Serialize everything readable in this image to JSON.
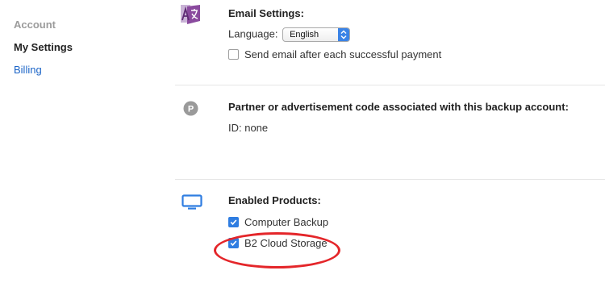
{
  "sidebar": {
    "heading": "Account",
    "items": [
      {
        "label": "My Settings",
        "active": true
      },
      {
        "label": "Billing",
        "active": false
      }
    ]
  },
  "email_settings": {
    "icon": "translate-icon",
    "title": "Email Settings:",
    "language_label": "Language:",
    "language_value": "English",
    "notify_label": "Send email after each successful payment",
    "notify_checked": false
  },
  "partner": {
    "icon": "p-badge-icon",
    "title": "Partner or advertisement code associated with this backup account:",
    "id_text": "ID: none"
  },
  "products": {
    "icon": "monitor-icon",
    "title": "Enabled Products:",
    "items": [
      {
        "label": "Computer Backup",
        "checked": true
      },
      {
        "label": "B2 Cloud Storage",
        "checked": true
      }
    ]
  },
  "colors": {
    "accent_blue": "#2f7de1",
    "link_blue": "#1b64c7",
    "annotation_red": "#e4262a",
    "icon_purple": "#8a4a9e"
  }
}
